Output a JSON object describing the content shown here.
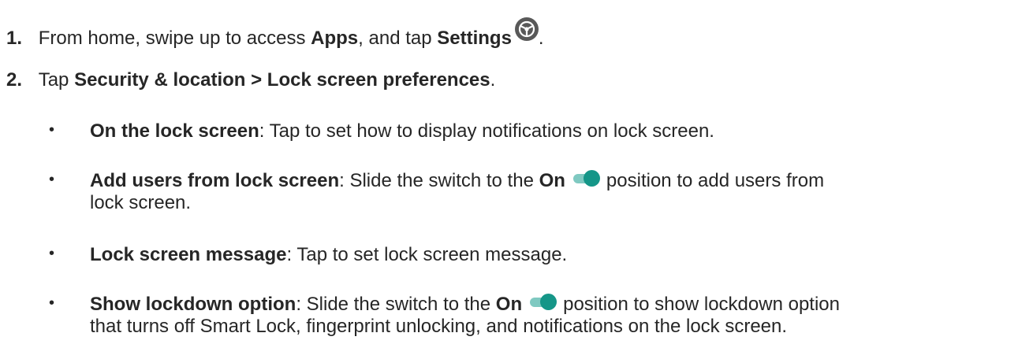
{
  "steps": [
    {
      "number": "1.",
      "text_a": "From home, swipe up to access ",
      "bold_a": "Apps",
      "text_b": ", and tap ",
      "bold_b": "Settings",
      "text_c": "."
    },
    {
      "number": "2.",
      "text_a": "Tap ",
      "bold_a": "Security & location > Lock screen preferences",
      "text_b": "."
    }
  ],
  "bullets": [
    {
      "symbol": "•",
      "bold": "On the lock screen",
      "text": ": Tap to set how to display notifications on lock screen."
    },
    {
      "symbol": "•",
      "bold": "Add users from lock screen",
      "text_a": ": Slide the switch to the ",
      "bold_b": "On",
      "text_b": "position to add users from",
      "line2": "lock screen."
    },
    {
      "symbol": "•",
      "bold": "Lock screen message",
      "text": ": Tap to set lock screen message."
    },
    {
      "symbol": "•",
      "bold": "Show lockdown option",
      "text_a": ": Slide the switch to the ",
      "bold_b": "On",
      "text_b": "position to show lockdown option",
      "line2": "that turns off Smart Lock, fingerprint unlocking, and notifications on the lock screen."
    }
  ],
  "icons": {
    "settings": "gear-icon",
    "toggle": "toggle-on-icon"
  },
  "colors": {
    "text": "#262626",
    "icon_gray": "#595959",
    "toggle_track": "#7fc9c1",
    "toggle_thumb": "#159688"
  }
}
